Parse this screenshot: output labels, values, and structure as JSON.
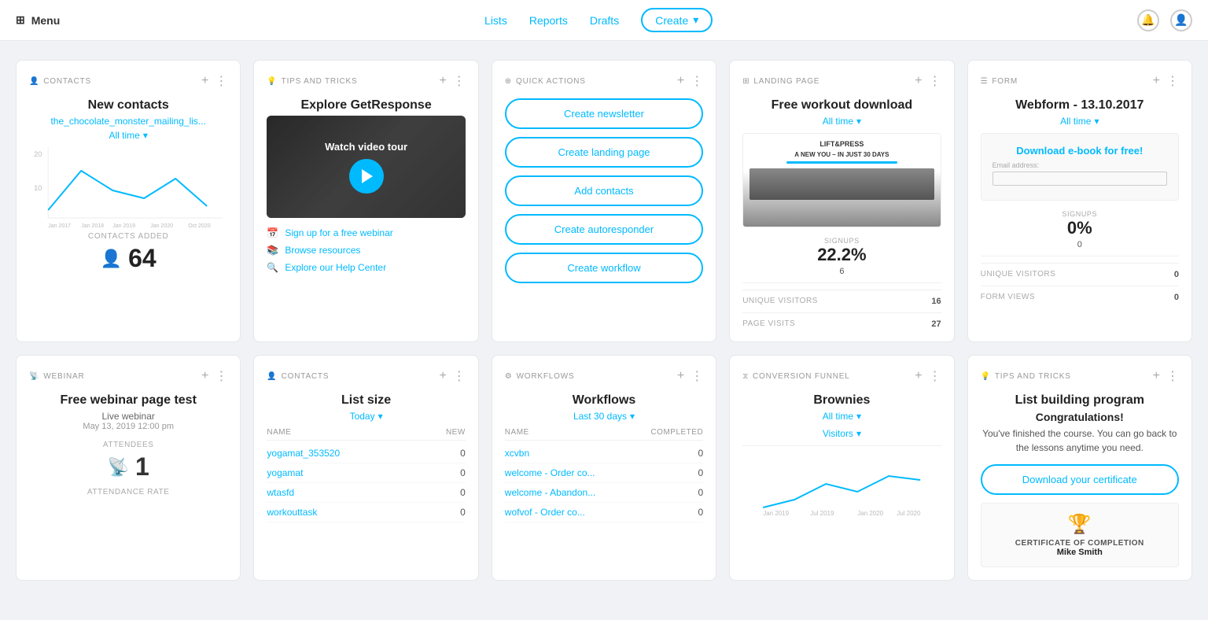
{
  "header": {
    "menu_label": "Menu",
    "nav_links": [
      "Lists",
      "Reports",
      "Drafts"
    ],
    "create_button": "Create",
    "notification_icon": "bell",
    "user_icon": "user"
  },
  "cards": {
    "contacts": {
      "label": "CONTACTS",
      "title": "New contacts",
      "list_link": "the_chocolate_monster_mailing_lis...",
      "all_time_label": "All time",
      "y_labels": [
        "20",
        "10"
      ],
      "x_labels": [
        "Jan 2017",
        "Jan 2018",
        "Jan 2019",
        "Jan 2020",
        "Oct 2020"
      ],
      "contacts_added_label": "CONTACTS ADDED",
      "count": "64"
    },
    "tips": {
      "label": "TIPS AND TRICKS",
      "title": "Explore GetResponse",
      "video_label": "Watch video tour",
      "links": [
        "Sign up for a free webinar",
        "Browse resources",
        "Explore our Help Center"
      ]
    },
    "quick_actions": {
      "label": "QUICK ACTIONS",
      "buttons": [
        "Create newsletter",
        "Create landing page",
        "Add contacts",
        "Create autoresponder",
        "Create workflow"
      ]
    },
    "landing_page": {
      "label": "LANDING PAGE",
      "title": "Free workout download",
      "all_time_label": "All time",
      "lp_brand": "LIFT&PRESS",
      "lp_headline": "A NEW YOU – IN JUST 30 DAYS",
      "signups_label": "SIGNUPS",
      "signups_pct": "22.2%",
      "signups_count": "6",
      "unique_visitors_label": "UNIQUE VISITORS",
      "unique_visitors_val": "16",
      "page_visits_label": "PAGE VISITS",
      "page_visits_val": "27"
    },
    "form": {
      "label": "FORM",
      "title": "Webform - 13.10.2017",
      "all_time_label": "All time",
      "form_title": "Download e-book for free!",
      "email_label": "Email address:",
      "signups_label": "SIGNUPS",
      "signups_pct": "0%",
      "signups_count": "0",
      "unique_visitors_label": "UNIQUE VISITORS",
      "unique_visitors_val": "0",
      "form_views_label": "FORM VIEWS",
      "form_views_val": "0"
    },
    "webinar": {
      "label": "WEBINAR",
      "title": "Free webinar page test",
      "subtitle": "Live webinar",
      "date": "May 13, 2019 12:00 pm",
      "attendees_label": "ATTENDEES",
      "attendees_count": "1",
      "attendance_rate_label": "ATTENDANCE RATE"
    },
    "list_size": {
      "label": "CONTACTS",
      "title": "List size",
      "period": "Today",
      "col_name": "NAME",
      "col_new": "NEW",
      "rows": [
        {
          "name": "yogamat_353520",
          "val": "0"
        },
        {
          "name": "yogamat",
          "val": "0"
        },
        {
          "name": "wtasfd",
          "val": "0"
        },
        {
          "name": "workouttask",
          "val": "0"
        }
      ]
    },
    "workflows": {
      "label": "WORKFLOWS",
      "title": "Workflows",
      "period": "Last 30 days",
      "col_name": "NAME",
      "col_completed": "COMPLETED",
      "rows": [
        {
          "name": "xcvbn",
          "val": "0"
        },
        {
          "name": "welcome - Order co...",
          "val": "0"
        },
        {
          "name": "welcome - Abandon...",
          "val": "0"
        },
        {
          "name": "wofvof - Order co...",
          "val": "0"
        }
      ]
    },
    "funnel": {
      "label": "CONVERSION FUNNEL",
      "title": "Brownies",
      "all_time_label": "All time",
      "visitors_label": "Visitors"
    },
    "tips_bottom": {
      "label": "TIPS AND TRICKS",
      "title": "List building program",
      "subtitle": "Congratulations!",
      "body": "You've finished the course. You can go back to the lessons anytime you need.",
      "download_btn": "Download your certificate",
      "cert_icon": "🏆",
      "cert_title": "CERTIFICATE OF COMPLETION",
      "cert_name": "Mike Smith"
    }
  }
}
